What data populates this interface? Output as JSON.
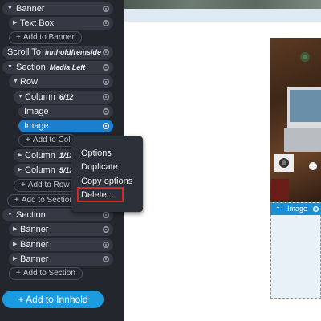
{
  "tree": {
    "banner": "Banner",
    "text_box": "Text Box",
    "add_to_banner": "Add to Banner",
    "scroll_to": "Scroll To",
    "scroll_tag": "innholdfremside",
    "section1": "Section",
    "section1_tag": "Media Left",
    "row": "Row",
    "column1": "Column",
    "column1_tag": "6/12",
    "image1": "Image",
    "image2": "Image",
    "add_to_column": "Add to Colum",
    "column2": "Column",
    "column2_tag": "1/12",
    "column3": "Column",
    "column3_tag": "5/12",
    "add_to_row": "Add to Row",
    "add_to_section1": "Add to Section",
    "section2": "Section",
    "banner2": "Banner",
    "banner3": "Banner",
    "banner4": "Banner",
    "add_to_section2": "Add to Section",
    "add_to_innhold": "Add to Innhold"
  },
  "context_menu": {
    "options": "Options",
    "duplicate": "Duplicate",
    "copy_options": "Copy options",
    "delete": "Delete..."
  },
  "canvas": {
    "image_toolbar_label": "Image"
  },
  "colors": {
    "selected": "#1b7fd0",
    "accent": "#1b9be0",
    "delete_highlight": "#e0231c"
  }
}
